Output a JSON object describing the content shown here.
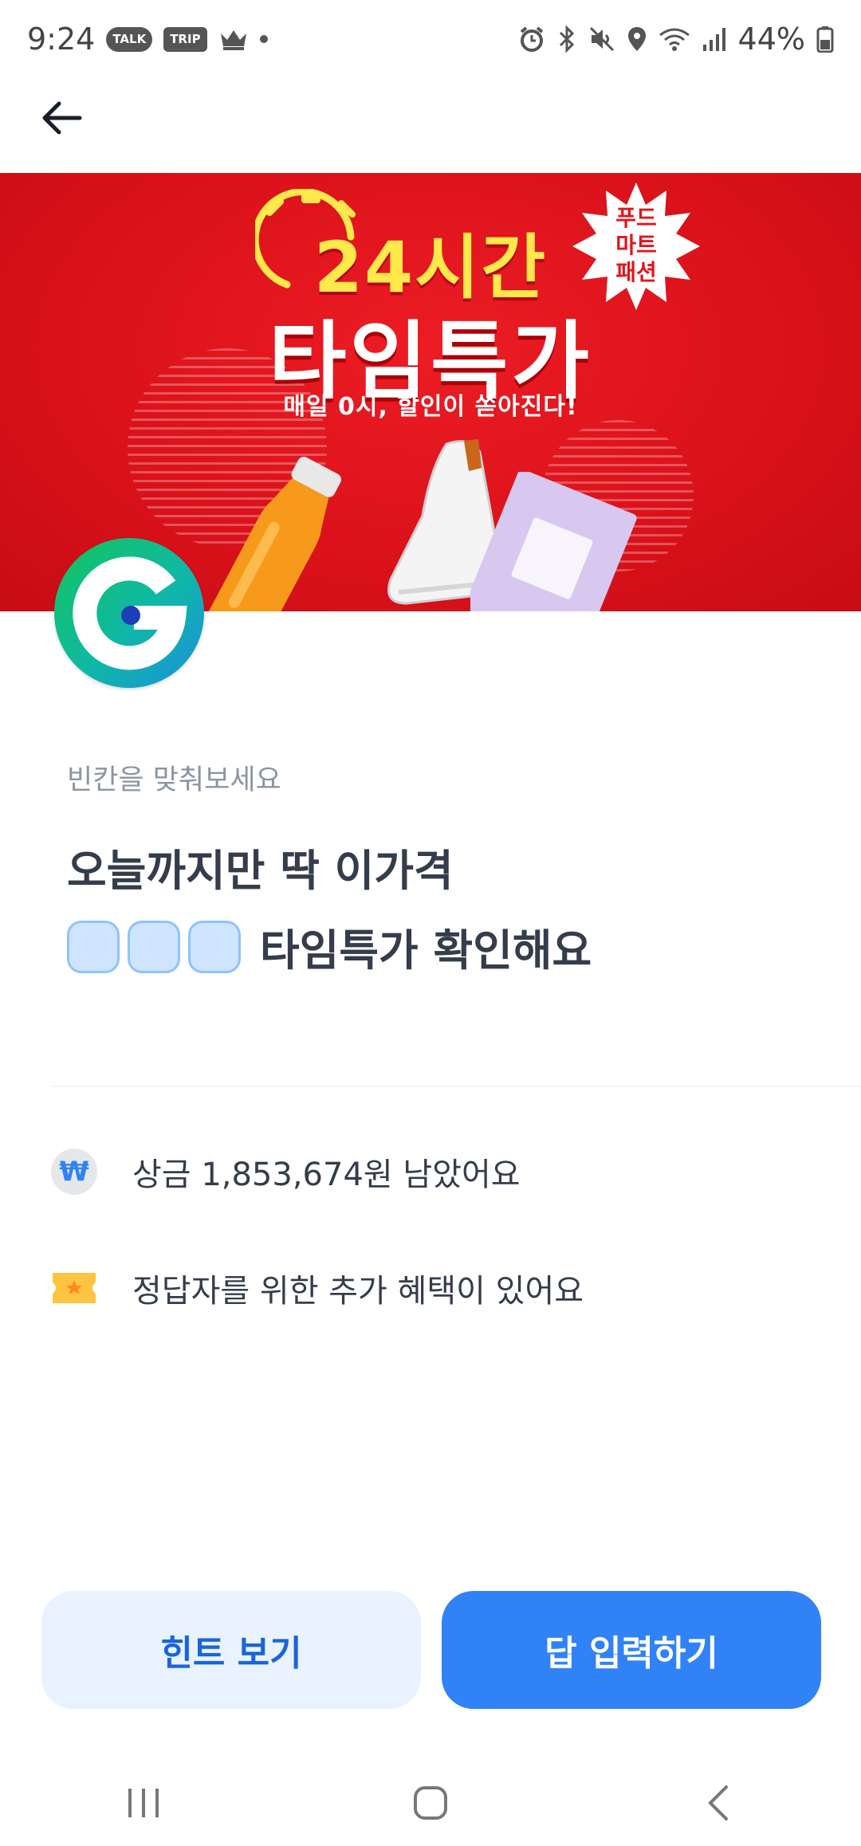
{
  "status_bar": {
    "time": "9:24",
    "badges": [
      "TALK",
      "TRIP"
    ],
    "battery": "44%"
  },
  "header": {
    "back_icon": "arrow-left-icon"
  },
  "banner": {
    "title_line_1": "24시간",
    "title_line_2": "타임특가",
    "subtitle": "매일 0시, 할인이 쏟아진다!",
    "burst_lines": [
      "푸드",
      "마트",
      "패션"
    ],
    "accent_color": "#e4141b",
    "title_color": "#ffe84a"
  },
  "brand": {
    "logo_icon": "g-logo-icon"
  },
  "quiz": {
    "label": "빈칸을 맞춰보세요",
    "line_1": "오늘까지만 딱 이가격",
    "blank_count": 3,
    "line_2_suffix": "타임특가 확인해요"
  },
  "info": {
    "prize_icon": "won-icon",
    "prize_text": "상금 1,853,674원 남았어요",
    "won_symbol": "₩",
    "bonus_icon": "ticket-icon",
    "bonus_text": "정답자를 위한 추가 혜택이 있어요"
  },
  "buttons": {
    "hint_label": "힌트 보기",
    "answer_label": "답 입력하기",
    "primary_color": "#3182f6"
  },
  "nav": {
    "recents_icon": "recents-icon",
    "home_icon": "home-icon",
    "back_icon": "chevron-left-icon"
  }
}
